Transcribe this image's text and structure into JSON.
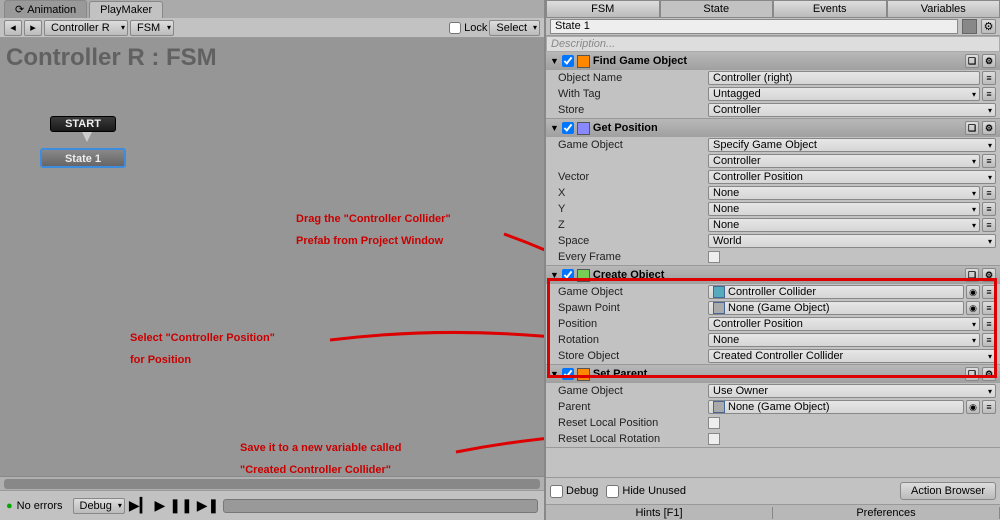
{
  "top": {
    "tab_anim": "Animation",
    "tab_pm": "PlayMaker"
  },
  "toolbar": {
    "controller": "Controller R",
    "fsm": "FSM",
    "lock": "Lock",
    "select": "Select"
  },
  "canvas": {
    "title": "Controller R : FSM",
    "start": "START",
    "state": "State 1"
  },
  "annotations": {
    "a1": "Drag the  \"Controller Collider\"",
    "a2": "Prefab from Project Window",
    "b1": "Select \"Controller Position\"",
    "b2": "for Position",
    "c1": "Save it to a new variable called",
    "c2": "\"Created Controller Collider\""
  },
  "bottom_left": {
    "noerrors": "No errors",
    "debug": "Debug"
  },
  "right_tabs": {
    "fsm": "FSM",
    "state": "State",
    "events": "Events",
    "variables": "Variables"
  },
  "state_hdr": {
    "name": "State 1",
    "desc": "Description..."
  },
  "actions": {
    "find": {
      "title": "Find Game Object",
      "rows": {
        "objname": {
          "label": "Object Name",
          "value": "Controller (right)"
        },
        "withtag": {
          "label": "With Tag",
          "value": "Untagged"
        },
        "store": {
          "label": "Store",
          "value": "Controller"
        }
      }
    },
    "getpos": {
      "title": "Get Position",
      "rows": {
        "gameobj": {
          "label": "Game Object",
          "value": "Specify Game Object"
        },
        "gameobj2": {
          "label": "",
          "value": "Controller"
        },
        "vector": {
          "label": "Vector",
          "value": "Controller Position"
        },
        "x": {
          "label": "X",
          "value": "None"
        },
        "y": {
          "label": "Y",
          "value": "None"
        },
        "z": {
          "label": "Z",
          "value": "None"
        },
        "space": {
          "label": "Space",
          "value": "World"
        },
        "every": {
          "label": "Every Frame"
        }
      }
    },
    "create": {
      "title": "Create Object",
      "rows": {
        "gameobj": {
          "label": "Game Object",
          "value": "Controller Collider"
        },
        "spawn": {
          "label": "Spawn Point",
          "value": "None (Game Object)"
        },
        "position": {
          "label": "Position",
          "value": "Controller Position"
        },
        "rotation": {
          "label": "Rotation",
          "value": "None"
        },
        "storeobj": {
          "label": "Store Object",
          "value": "Created Controller Collider"
        }
      }
    },
    "setparent": {
      "title": "Set Parent",
      "rows": {
        "gameobj": {
          "label": "Game Object",
          "value": "Use Owner"
        },
        "parent": {
          "label": "Parent",
          "value": "None (Game Object)"
        },
        "resetpos": {
          "label": "Reset Local Position"
        },
        "resetrot": {
          "label": "Reset Local Rotation"
        }
      }
    }
  },
  "right_bottom": {
    "debug": "Debug",
    "hide": "Hide Unused",
    "browser": "Action Browser"
  },
  "hints": {
    "hints": "Hints [F1]",
    "prefs": "Preferences"
  }
}
